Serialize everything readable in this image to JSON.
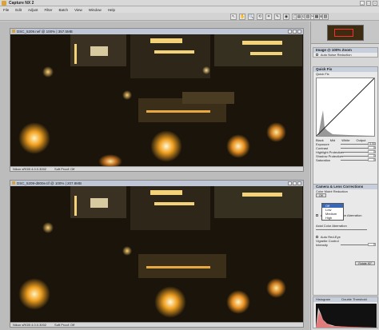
{
  "app": {
    "title": "Capture NX 2"
  },
  "menu": [
    "File",
    "Edit",
    "Adjust",
    "Filter",
    "Batch",
    "View",
    "Window",
    "Help"
  ],
  "toolbar": {
    "tools": [
      "↖",
      "✋",
      "🔍",
      "⟲",
      "⌗",
      "✎",
      "◉",
      "▢",
      "⊙",
      "✂",
      "⊕"
    ],
    "right_tools": [
      "▤",
      "▥",
      "▦",
      "▧"
    ]
  },
  "windows": [
    {
      "title": "DSC_5209.nef @ 100% | 357.5MB",
      "status_left": "Nikon sRGB 4.0.0.3002",
      "status_right": "Soft Proof: Off"
    },
    {
      "title": "DSC_5209-d800e.tif @ 100% | 207.8MB",
      "status_left": "Nikon sRGB 4.0.0.3002",
      "status_right": "Soft Proof: Off"
    }
  ],
  "panel": {
    "image_section": {
      "header": "Image @ 100% Zoom",
      "noise_label": "Auto Noise Reduction"
    },
    "quick_fix": {
      "header": "Quick Fix",
      "sub": "Quick Fix",
      "channel_labels": [
        "Black",
        "Mid",
        "White"
      ],
      "output_label": "Output",
      "sliders": [
        {
          "label": "Exposure",
          "value": "0.00"
        },
        {
          "label": "Contrast",
          "value": "0"
        },
        {
          "label": "Highlight Protection",
          "value": "0"
        },
        {
          "label": "Shadow Protection",
          "value": "0"
        },
        {
          "label": "Saturation",
          "value": "0"
        }
      ]
    },
    "camera_lens": {
      "header": "Camera & Lens Corrections",
      "color_moire": "Color Moiré Reduction",
      "dropdown_options": [
        "Off",
        "Low",
        "Medium",
        "High"
      ],
      "dropdown_selected": "Off",
      "auto_ca": "Auto Lateral Color Aberration",
      "axial": "Axial Color Aberration",
      "auto_red_eye": "Auto Red-Eye",
      "vignette": "Vignette Control",
      "intensity": "Intensity",
      "intensity_value": "0",
      "button": "Rotate 90°"
    },
    "histogram": {
      "label": "Histogram",
      "mode": "Double Threshold"
    }
  },
  "colors": {
    "accent": "#3a66b8",
    "title_bar": "#c0c8d8"
  }
}
